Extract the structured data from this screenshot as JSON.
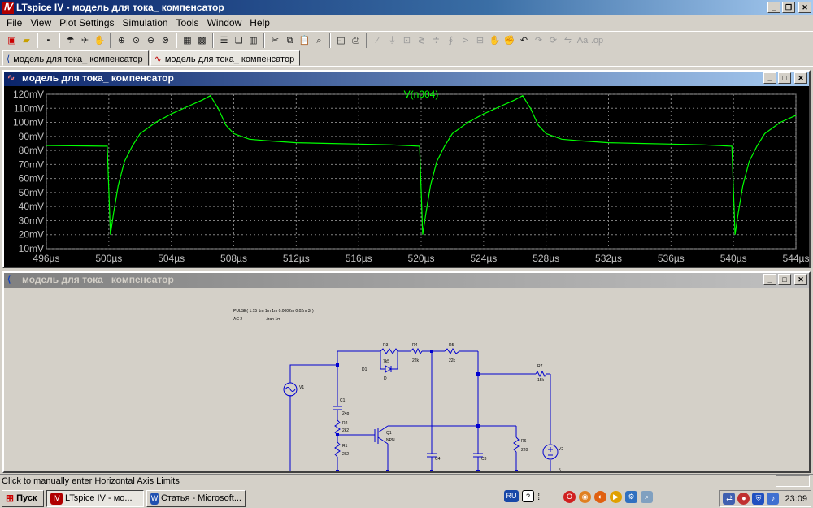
{
  "app": {
    "title": "LTspice IV - модель для тока_ компенсатор",
    "icon_glyph": "Ⅳ"
  },
  "menu": [
    "File",
    "View",
    "Plot Settings",
    "Simulation",
    "Tools",
    "Window",
    "Help"
  ],
  "tabs": [
    {
      "label": "модель для тока_ компенсатор",
      "icon": "schematic-icon"
    },
    {
      "label": "модель для тока_ компенсатор",
      "icon": "waveform-icon"
    }
  ],
  "plot_window": {
    "title": "модель для тока_ компенсатор"
  },
  "schematic_window": {
    "title": "модель для тока_ компенсатор"
  },
  "chart_data": {
    "type": "line",
    "title": "V(n004)",
    "series_color": "#00ff00",
    "xlim": [
      496,
      544
    ],
    "ylim": [
      10,
      120
    ],
    "xticks": [
      "496µs",
      "500µs",
      "504µs",
      "508µs",
      "512µs",
      "516µs",
      "520µs",
      "524µs",
      "528µs",
      "532µs",
      "536µs",
      "540µs",
      "544µs"
    ],
    "yticks": [
      "120mV",
      "110mV",
      "100mV",
      "90mV",
      "80mV",
      "70mV",
      "60mV",
      "50mV",
      "40mV",
      "30mV",
      "20mV",
      "10mV"
    ],
    "grid": true,
    "series": [
      {
        "name": "V(n004)",
        "x": [
          496,
          499.9,
          500.1,
          500.3,
          500.6,
          501,
          501.5,
          502,
          503,
          504,
          505,
          506,
          506.5,
          507,
          507.5,
          508,
          509,
          510,
          512,
          514,
          516,
          518,
          519.9,
          520.1,
          520.3,
          520.6,
          521,
          521.5,
          522,
          523,
          524,
          525,
          526,
          526.5,
          527,
          527.5,
          528,
          529,
          530,
          532,
          534,
          536,
          538,
          539.9,
          540.1,
          540.3,
          540.6,
          541,
          541.5,
          542,
          543,
          544
        ],
        "y": [
          83.5,
          83,
          20,
          35,
          55,
          72,
          83,
          92,
          100,
          106,
          111,
          116,
          119,
          110,
          98,
          92,
          88,
          87,
          85.5,
          85,
          84.5,
          84,
          83,
          20,
          35,
          55,
          72,
          83,
          92,
          100,
          106,
          111,
          116,
          119,
          110,
          98,
          92,
          88,
          87,
          85.5,
          85,
          84.5,
          84,
          83,
          20,
          35,
          55,
          72,
          83,
          92,
          100,
          105
        ]
      }
    ]
  },
  "schematic": {
    "directive_pulse": "PULSE( 1.15 1m 1m 1m 0.0002m 0.02m 3i )",
    "directive_ac": "AC 2",
    "directive_tran": ".tran 1m",
    "labels": {
      "V1": "V1",
      "C1": "C1",
      "C1v": "24p",
      "R2": "R2",
      "R2v": "2k2",
      "R1": "R1",
      "R1v": "2k2",
      "R3": "R3",
      "R3v": "7k5",
      "D1": "D1",
      "Dm": "D",
      "R4": "R4",
      "R4v": "22k",
      "R5": "R5",
      "R5v": "22k",
      "Q1": "Q1",
      "Q1m": "NPN",
      "C4": "C4",
      "C4v": "10n2",
      "C3": "C3",
      "C3v": "10n2",
      "R6": "R6",
      "R6v": "220",
      "R7": "R7",
      "R7v": "15k",
      "V2": "V2",
      "V2v": "5"
    }
  },
  "status": {
    "text": "Click to manually enter Horizontal Axis Limits"
  },
  "taskbar": {
    "start": "Пуск",
    "items": [
      {
        "label": "LTspice IV - мо...",
        "active": true
      },
      {
        "label": "Статья - Microsoft...",
        "active": false
      }
    ],
    "lang": "RU",
    "clock": "23:09"
  }
}
